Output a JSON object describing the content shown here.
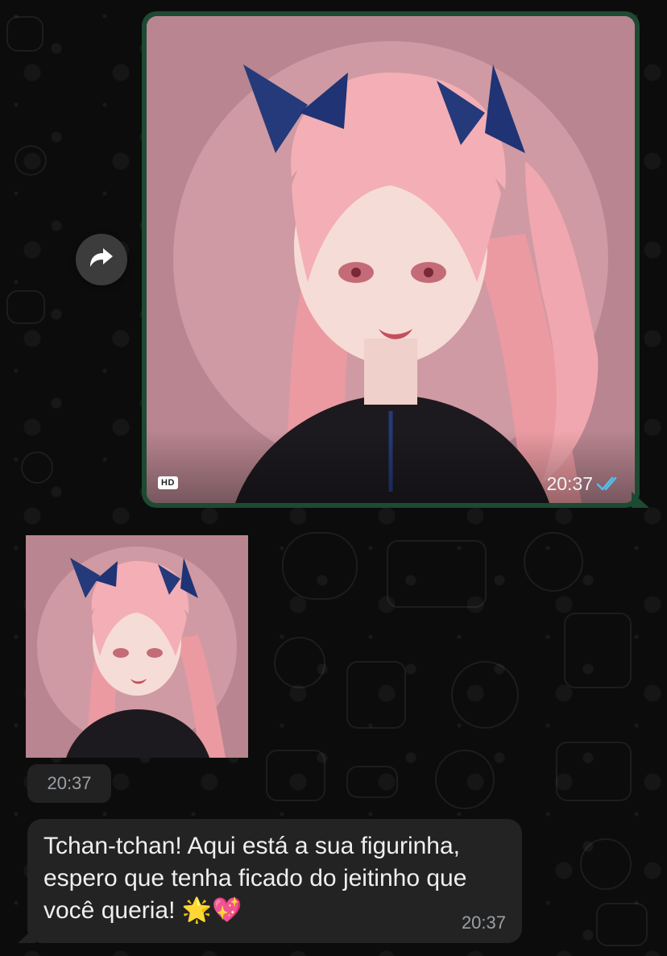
{
  "outgoing_message": {
    "hd_label": "HD",
    "time": "20:37",
    "status": "read",
    "tick_icon": "double-check-icon"
  },
  "forward_button": {
    "icon": "forward-arrow-icon"
  },
  "sticker_message": {
    "time": "20:37"
  },
  "incoming_message": {
    "text": "Tchan-tchan! Aqui está a sua figurinha, espero que tenha ficado do jeitinho que você queria! 🌟💖",
    "time": "20:37"
  },
  "colors": {
    "background": "#0c0c0c",
    "outgoing_bubble": "#1d4a32",
    "incoming_bubble": "#232323",
    "read_ticks": "#53bdeb",
    "image_background": "#b88590"
  }
}
